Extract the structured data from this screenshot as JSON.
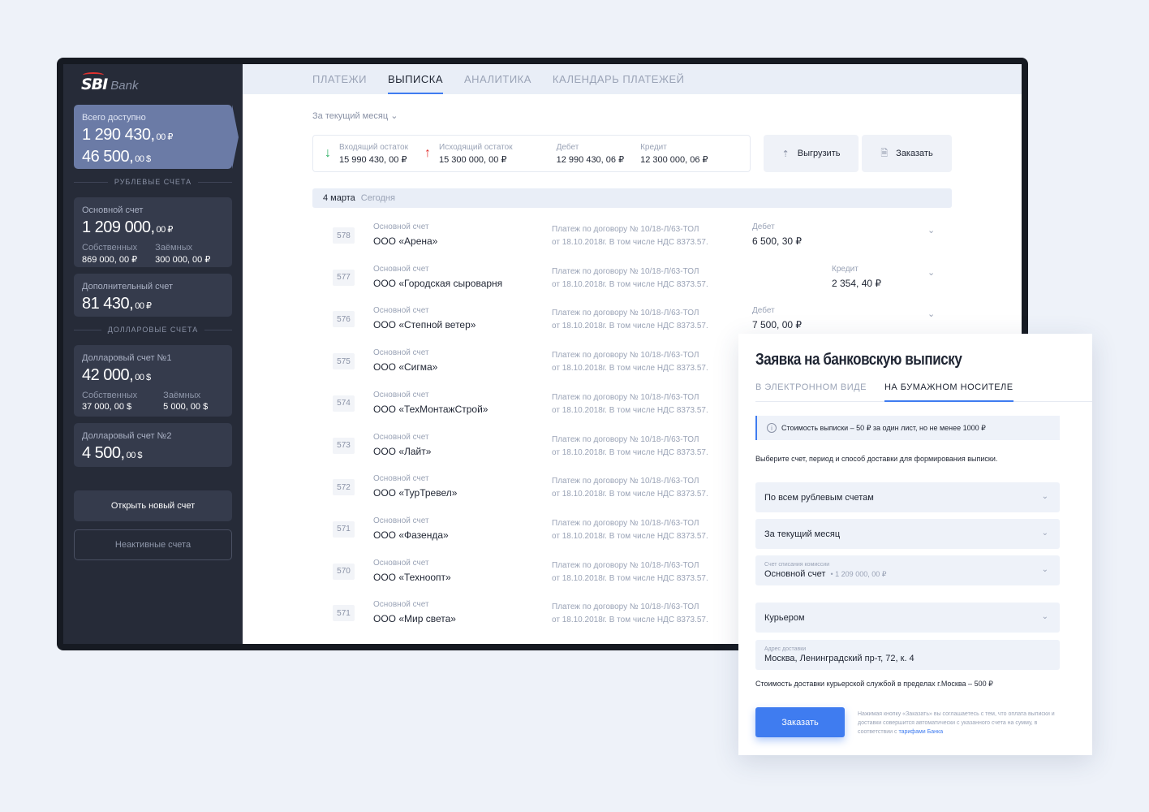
{
  "brand": {
    "logo": "SBI",
    "sub": "Bank"
  },
  "sidebar": {
    "total": {
      "label": "Всего доступно",
      "line1": "1 290 430,",
      "line1_small": "00 ₽",
      "line2": "46 500,",
      "line2_small": "00 $"
    },
    "rub_title": "РУБЛЕВЫЕ СЧЕТА",
    "usd_title": "ДОЛЛАРОВЫЕ СЧЕТА",
    "accounts": [
      {
        "label": "Основной счет",
        "amount": "1 209 000,",
        "small": "00 ₽",
        "own_label": "Собственных",
        "own": "869 000, 00 ₽",
        "loan_label": "Заёмных",
        "loan": "300 000, 00 ₽"
      },
      {
        "label": "Дополнительный счет",
        "amount": "81 430,",
        "small": "00 ₽"
      },
      {
        "label": "Долларовый счет №1",
        "amount": "42 000,",
        "small": "00 $",
        "own_label": "Собственных",
        "own": "37 000, 00 $",
        "loan_label": "Заёмных",
        "loan": "5 000, 00 $"
      },
      {
        "label": "Долларовый счет №2",
        "amount": "4 500,",
        "small": "00 $"
      }
    ],
    "open_new": "Открыть новый счет",
    "inactive": "Неактивные счета"
  },
  "tabs": [
    "ПЛАТЕЖИ",
    "ВЫПИСКА",
    "АНАЛИТИКА",
    "КАЛЕНДАРЬ ПЛАТЕЖЕЙ"
  ],
  "period": "За текущий месяц",
  "summary": {
    "in_label": "Входящий остаток",
    "in": "15 990 430, 00 ₽",
    "out_label": "Исходящий остаток",
    "out": "15 300 000, 00 ₽",
    "debit_label": "Дебет",
    "debit": "12 990 430, 06 ₽",
    "credit_label": "Кредит",
    "credit": "12 300 000, 06 ₽"
  },
  "actions": {
    "export": "Выгрузить",
    "order": "Заказать"
  },
  "day": {
    "date": "4 марта",
    "today": "Сегодня"
  },
  "payment_line1": "Платеж по  договору № 10/18-Л/63-ТОЛ",
  "payment_line2": "от 18.10.2018г. В том числе НДС 8373.57.",
  "account_label": "Основной счет",
  "transactions": [
    {
      "num": "578",
      "company": "ООО «Арена»",
      "type": "Дебет",
      "amount": "6 500, 30 ₽"
    },
    {
      "num": "577",
      "company": "ООО «Городская сыроварня",
      "type": "Кредит",
      "amount": "2 354, 40 ₽"
    },
    {
      "num": "576",
      "company": "ООО «Степной ветер»",
      "type": "Дебет",
      "amount": "7 500, 00 ₽"
    },
    {
      "num": "575",
      "company": "ООО «Сигма»"
    },
    {
      "num": "574",
      "company": "ООО «ТехМонтажСтрой»"
    },
    {
      "num": "573",
      "company": "ООО «Лайт»"
    },
    {
      "num": "572",
      "company": "ООО «ТурТревел»"
    },
    {
      "num": "571",
      "company": "ООО «Фазенда»"
    },
    {
      "num": "570",
      "company": "ООО «Техноопт»"
    },
    {
      "num": "571",
      "company": "ООО «Мир света»"
    }
  ],
  "dialog": {
    "title": "Заявка на банковскую выписку",
    "tabs": [
      "В ЭЛЕКТРОННОМ ВИДЕ",
      "НА БУМАЖНОМ НОСИТЕЛЕ"
    ],
    "info": "Стоимость выписки – 50 ₽ за один лист, но не менее 1000 ₽",
    "hint": "Выберите счет, период и способ доставки для формирования выписки.",
    "accounts_select": "По всем рублевым счетам",
    "period_select": "За текущий месяц",
    "commission_label": "Счет списания комиссии",
    "commission_account": "Основной счет",
    "commission_amount": "• 1 209 000, 00 ₽",
    "delivery_select": "Курьером",
    "address_label": "Адрес доставки",
    "address": "Москва, Ленинградский пр-т, 72, к. 4",
    "delivery_cost": "Стоимость доставки курьерской службой в пределах г.Москва – 500 ₽",
    "order_button": "Заказать",
    "note": "Нажимая кнопку «Заказать» вы соглашаетесь с тем, что оплата выписки и доставки совершится автоматически с указанного счета на сумму, в соответствии с ",
    "note_link": "тарифами Банка"
  }
}
